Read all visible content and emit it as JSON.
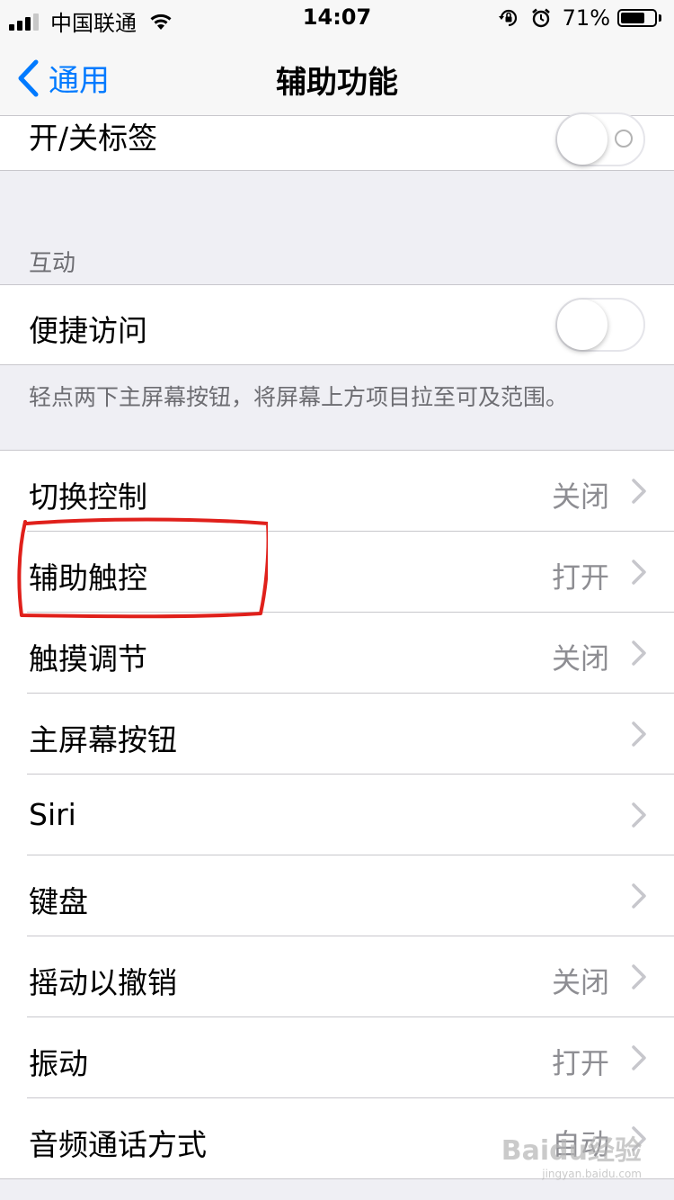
{
  "status_bar": {
    "carrier": "中国联通",
    "time": "14:07",
    "battery": "71%",
    "battery_level": 0.71,
    "icons": [
      "cellular-signal-icon",
      "wifi-icon",
      "orientation-lock-icon",
      "alarm-icon",
      "battery-icon"
    ]
  },
  "nav": {
    "back_label": "通用",
    "title": "辅助功能"
  },
  "top_row": {
    "label": "开/关标签",
    "toggle_on": false
  },
  "interaction": {
    "header": "互动",
    "reachability": {
      "label": "便捷访问",
      "toggle_on": false
    },
    "footer": "轻点两下主屏幕按钮，将屏幕上方项目拉至可及范围。"
  },
  "list": [
    {
      "label": "切换控制",
      "value": "关闭"
    },
    {
      "label": "辅助触控",
      "value": "打开"
    },
    {
      "label": "触摸调节",
      "value": "关闭"
    },
    {
      "label": "主屏幕按钮",
      "value": ""
    },
    {
      "label": "Siri",
      "value": ""
    },
    {
      "label": "键盘",
      "value": ""
    },
    {
      "label": "摇动以撤销",
      "value": "关闭"
    },
    {
      "label": "振动",
      "value": "打开"
    },
    {
      "label": "音频通话方式",
      "value": "自动"
    }
  ],
  "watermark": {
    "main": "Baidu经验",
    "sub": "jingyan.baidu.com"
  },
  "colors": {
    "accent": "#007aff",
    "highlight": "#e0201b",
    "background": "#efeff4"
  }
}
